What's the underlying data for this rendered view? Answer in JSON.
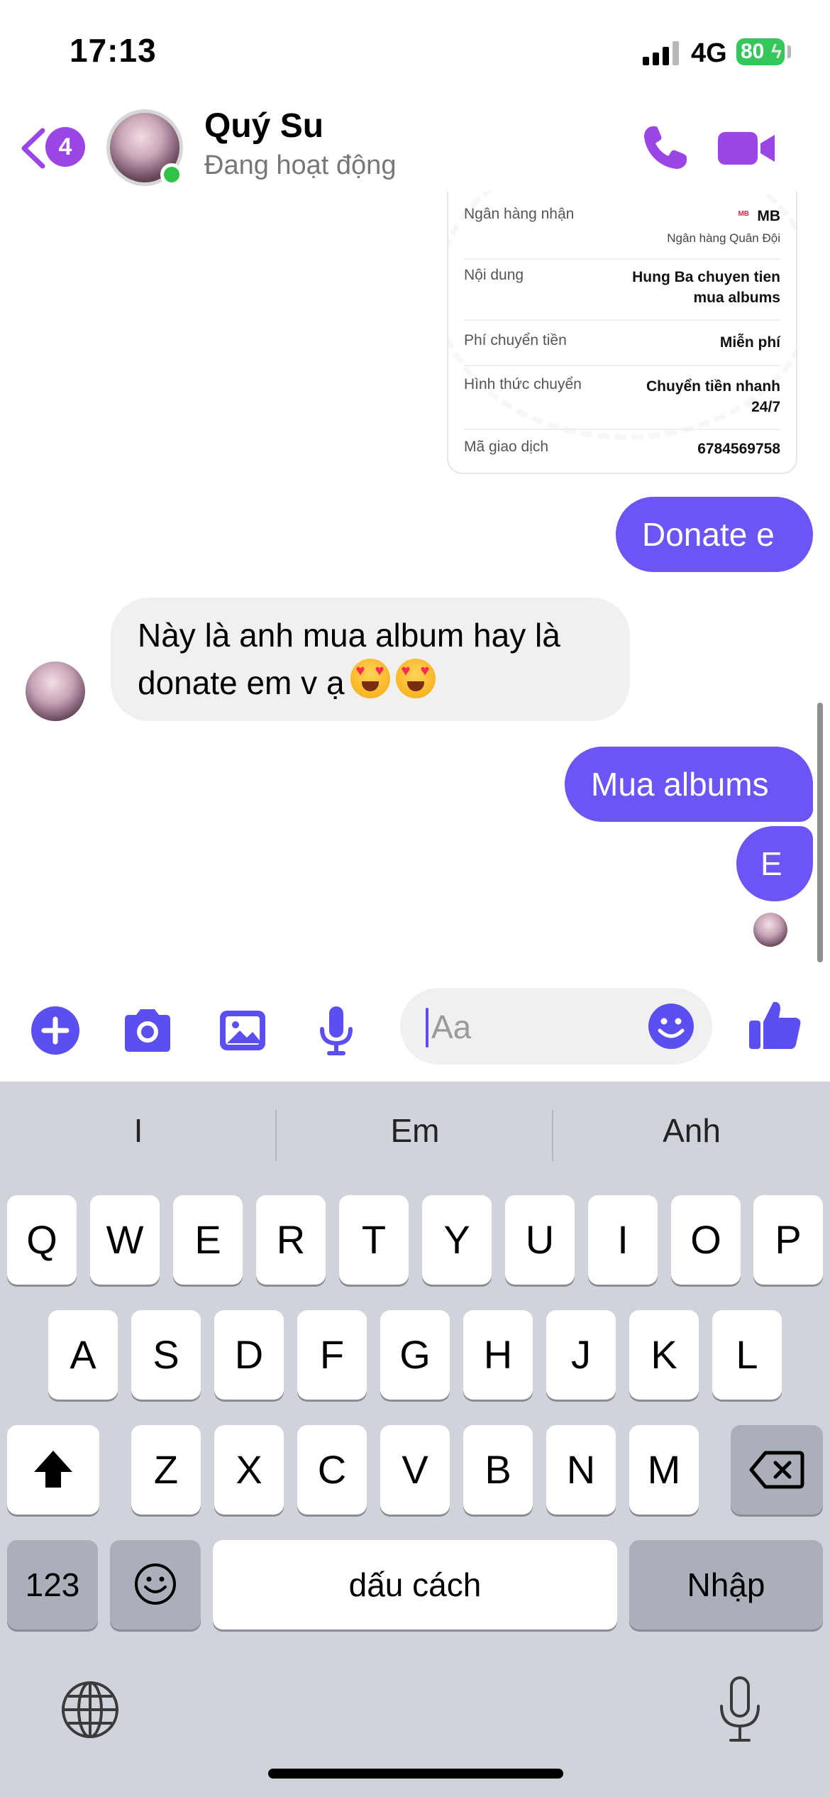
{
  "status_bar": {
    "time": "17:13",
    "network": "4G",
    "battery": "80"
  },
  "header": {
    "back_badge": "4",
    "contact_name": "Quý Su",
    "contact_status": "Đang hoạt động"
  },
  "receipt": {
    "rows": [
      {
        "label": "Ngân hàng nhận",
        "value": "MB",
        "sub": "Ngân hàng Quân Đội"
      },
      {
        "label": "Nội dung",
        "value_line1": "Hung Ba  chuyen tien",
        "value_line2": "mua albums"
      },
      {
        "label": "Phí chuyển tiền",
        "value": "Miễn phí"
      },
      {
        "label": "Hình thức chuyển",
        "value_line1": "Chuyển tiền nhanh",
        "value_line2": "24/7"
      },
      {
        "label": "Mã giao dịch",
        "value": "6784569758"
      }
    ],
    "logo": "MB"
  },
  "messages": {
    "donate": "Donate e",
    "received": "Này là anh mua album hay là donate em v ạ",
    "albums": "Mua albums",
    "e": "E"
  },
  "composer": {
    "placeholder": "Aa"
  },
  "keyboard": {
    "suggestions": [
      "I",
      "Em",
      "Anh"
    ],
    "row1": [
      "Q",
      "W",
      "E",
      "R",
      "T",
      "Y",
      "U",
      "I",
      "O",
      "P"
    ],
    "row2": [
      "A",
      "S",
      "D",
      "F",
      "G",
      "H",
      "J",
      "K",
      "L"
    ],
    "row3": [
      "Z",
      "X",
      "C",
      "V",
      "B",
      "N",
      "M"
    ],
    "numbers_label": "123",
    "space_label": "dấu cách",
    "return_label": "Nhập"
  },
  "colors": {
    "accent": "#6b55f5",
    "icon_purple": "#9b45e6",
    "online": "#31c24a",
    "keyboard_bg": "#d1d3da"
  }
}
